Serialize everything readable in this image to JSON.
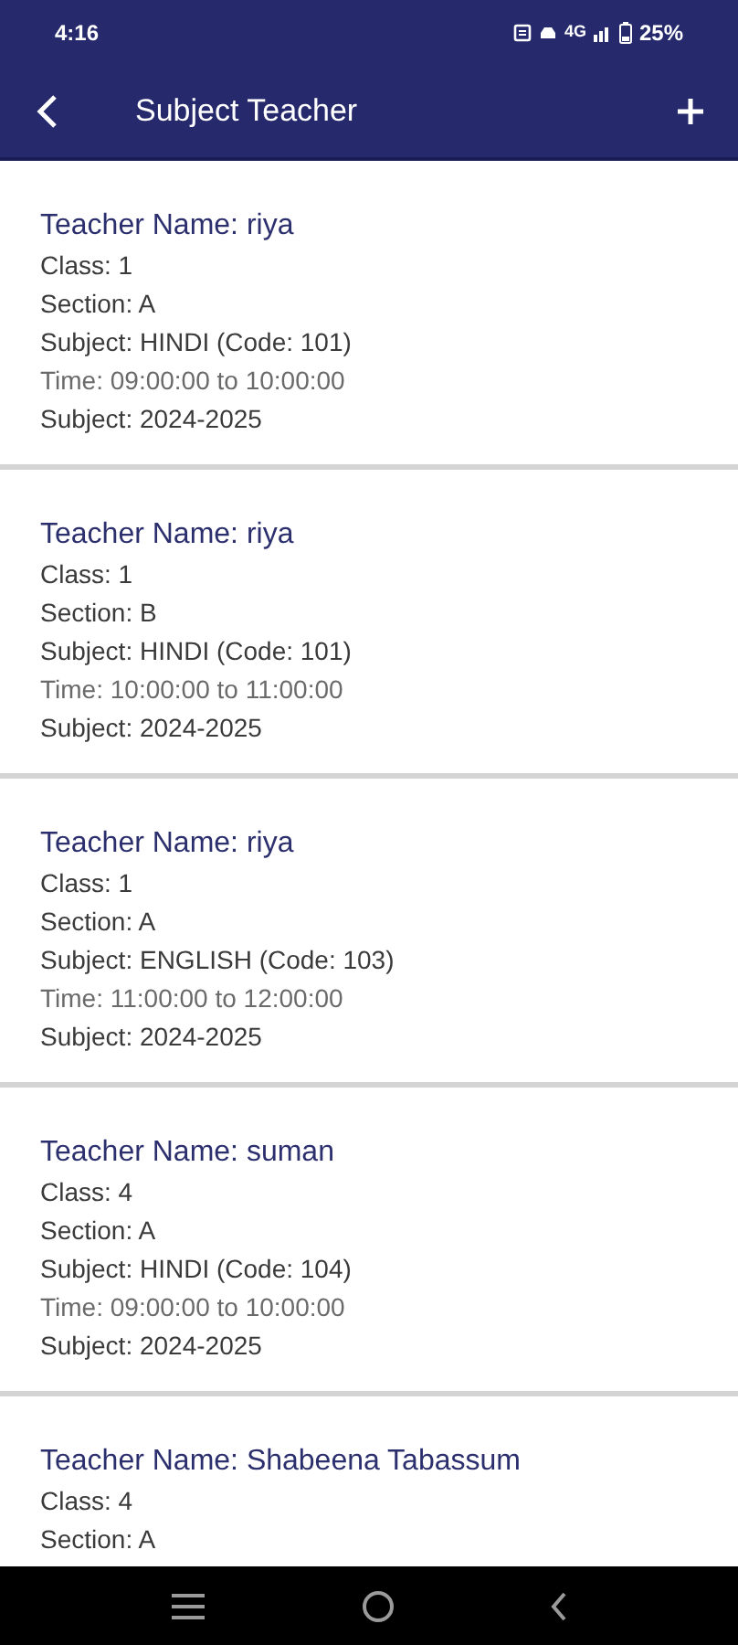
{
  "status_bar": {
    "time": "4:16",
    "network": "4G",
    "battery": "25%"
  },
  "app_bar": {
    "title": "Subject Teacher"
  },
  "cards": [
    {
      "lines": [
        {
          "kind": "heading",
          "text": "Teacher Name: riya"
        },
        {
          "kind": "detail",
          "text": "Class: 1"
        },
        {
          "kind": "detail",
          "text": "Section: A"
        },
        {
          "kind": "detail",
          "text": "Subject: HINDI (Code: 101)"
        },
        {
          "kind": "muted",
          "text": "Time: 09:00:00 to 10:00:00"
        },
        {
          "kind": "detail",
          "text": "Subject: 2024-2025"
        }
      ]
    },
    {
      "lines": [
        {
          "kind": "heading",
          "text": "Teacher Name: riya"
        },
        {
          "kind": "detail",
          "text": "Class: 1"
        },
        {
          "kind": "detail",
          "text": "Section: B"
        },
        {
          "kind": "detail",
          "text": "Subject: HINDI (Code: 101)"
        },
        {
          "kind": "muted",
          "text": "Time: 10:00:00 to 11:00:00"
        },
        {
          "kind": "detail",
          "text": "Subject: 2024-2025"
        }
      ]
    },
    {
      "lines": [
        {
          "kind": "heading",
          "text": "Teacher Name: riya"
        },
        {
          "kind": "detail",
          "text": "Class: 1"
        },
        {
          "kind": "detail",
          "text": "Section: A"
        },
        {
          "kind": "detail",
          "text": "Subject: ENGLISH (Code: 103)"
        },
        {
          "kind": "muted",
          "text": "Time: 11:00:00 to 12:00:00"
        },
        {
          "kind": "detail",
          "text": "Subject: 2024-2025"
        }
      ]
    },
    {
      "lines": [
        {
          "kind": "heading",
          "text": "Teacher Name: suman"
        },
        {
          "kind": "detail",
          "text": "Class: 4"
        },
        {
          "kind": "detail",
          "text": "Section: A"
        },
        {
          "kind": "detail",
          "text": "Subject: HINDI (Code: 104)"
        },
        {
          "kind": "muted",
          "text": "Time: 09:00:00 to 10:00:00"
        },
        {
          "kind": "detail",
          "text": "Subject: 2024-2025"
        }
      ]
    },
    {
      "lines": [
        {
          "kind": "heading",
          "text": "Teacher Name: Shabeena Tabassum"
        },
        {
          "kind": "detail",
          "text": "Class: 4"
        },
        {
          "kind": "detail",
          "text": "Section: A"
        }
      ]
    }
  ]
}
